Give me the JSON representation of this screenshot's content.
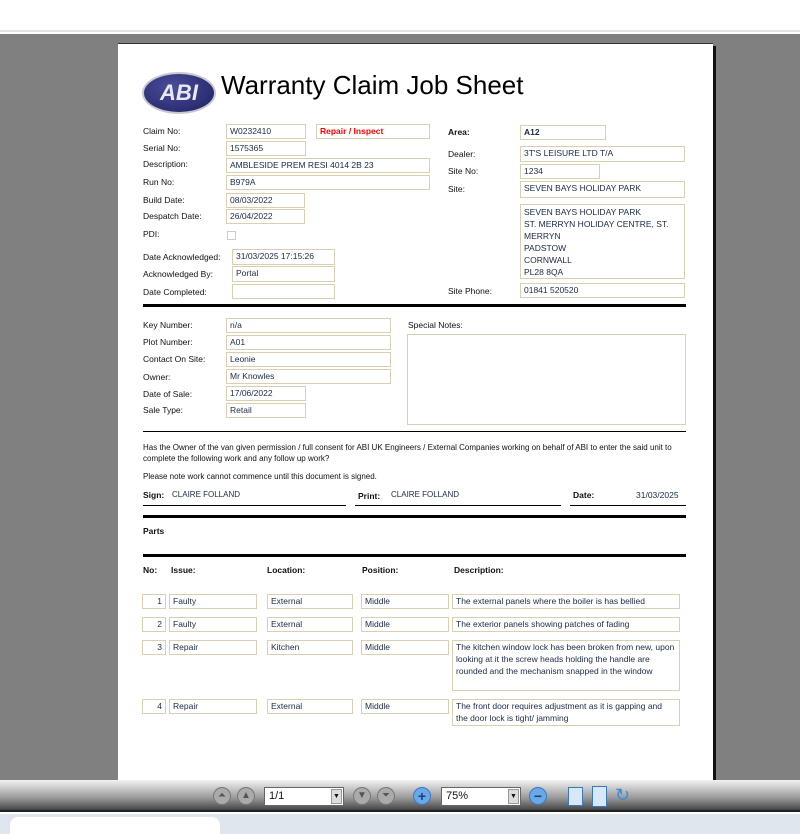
{
  "doc": {
    "title": "Warranty Claim Job Sheet",
    "logo_text": "ABI",
    "labels": {
      "claim_no": "Claim No:",
      "serial_no": "Serial No:",
      "description": "Description:",
      "run_no": "Run No:",
      "build_date": "Build Date:",
      "despatch_date": "Despatch Date:",
      "pdi": "PDI:",
      "date_ack": "Date Acknowledged:",
      "ack_by": "Acknowledged By:",
      "date_completed": "Date Completed:",
      "area": "Area:",
      "dealer": "Dealer:",
      "site_no": "Site No:",
      "site": "Site:",
      "site_phone": "Site Phone:",
      "key_number": "Key Number:",
      "plot_number": "Plot Number:",
      "contact": "Contact On Site:",
      "owner": "Owner:",
      "date_of_sale": "Date of Sale:",
      "sale_type": "Sale Type:",
      "special_notes": "Special Notes:",
      "sign": "Sign:",
      "print": "Print:",
      "date": "Date:",
      "parts": "Parts"
    },
    "values": {
      "claim_no": "W0232410",
      "claim_type": "Repair / Inspect",
      "serial_no": "1575365",
      "description": "AMBLESIDE PREM RESI 4014 2B 23",
      "run_no": "B979A",
      "build_date": "08/03/2022",
      "despatch_date": "26/04/2022",
      "pdi_checked": false,
      "date_ack": "31/03/2025 17:15:26",
      "ack_by": "Portal",
      "date_completed": "",
      "area": "A12",
      "dealer": "3T'S LEISURE LTD T/A",
      "site_no": "1234",
      "site": "SEVEN BAYS HOLIDAY PARK",
      "address": [
        "SEVEN BAYS HOLIDAY PARK",
        "ST. MERRYN HOLIDAY CENTRE, ST.",
        "MERRYN",
        "PADSTOW",
        "CORNWALL",
        "PL28 8QA"
      ],
      "site_phone": "01841 520520",
      "key_number": "n/a",
      "plot_number": "A01",
      "contact": "Leonie",
      "owner": "Mr Knowles",
      "date_of_sale": "17/06/2022",
      "sale_type": "Retail",
      "special_notes": "",
      "sign": "CLAIRE FOLLAND",
      "print": "CLAIRE FOLLAND",
      "date": "31/03/2025"
    },
    "consent_text": "Has the Owner of the van given permission / full consent for ABI UK Engineers / External Companies working on behalf of ABI to enter the said unit to complete the following work and any follow up work?",
    "note_text": "Please note work cannot commence until this document is signed.",
    "parts_headers": [
      "No:",
      "Issue:",
      "Location:",
      "Position:",
      "Description:"
    ],
    "parts": [
      {
        "no": "1",
        "issue": "Faulty",
        "location": "External",
        "position": "Middle",
        "description": "The external panels where the boiler is has bellied"
      },
      {
        "no": "2",
        "issue": "Faulty",
        "location": "External",
        "position": "Middle",
        "description": "The exterior panels showing patches of fading"
      },
      {
        "no": "3",
        "issue": "Repair",
        "location": "Kitchen",
        "position": "Middle",
        "description": "The kitchen window lock has been broken from new, upon looking at it the screw heads holding the handle are rounded and the mechanism snapped in the window"
      },
      {
        "no": "4",
        "issue": "Repair",
        "location": "External",
        "position": "Middle",
        "description": "The front door requires adjustment as it is gapping and the door lock is tight/ jamming"
      }
    ]
  },
  "toolbar": {
    "page": "1/1",
    "zoom": "75%"
  },
  "colors": {
    "claim_type": "#ff0000",
    "field_border": "#d9d0b4",
    "logo": "#2b2d6e"
  }
}
